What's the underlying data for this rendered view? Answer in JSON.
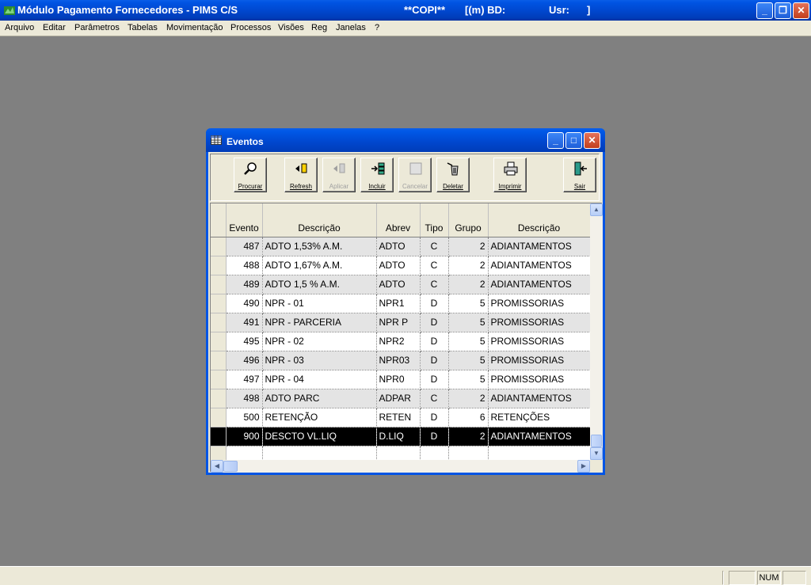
{
  "app": {
    "title": "Módulo Pagamento Fornecedores - PIMS C/S",
    "company": "**COPI**",
    "db_label": "[(m) BD:",
    "user_label": "Usr:",
    "close_bracket": "]",
    "win_buttons": {
      "minimize": "_",
      "restore": "❐",
      "close": "✕"
    }
  },
  "menu": {
    "items": [
      "Arquivo",
      "Editar",
      "Parâmetros",
      "Tabelas",
      "Movimentação",
      "Processos",
      "Visões",
      "Reg",
      "Janelas",
      "?"
    ]
  },
  "window": {
    "title": "Eventos",
    "buttons": {
      "minimize": "_",
      "maximize": "□",
      "close": "✕"
    }
  },
  "toolbar": {
    "buttons": [
      {
        "label": "Procurar",
        "enabled": true
      },
      {
        "label": "Refresh",
        "enabled": true
      },
      {
        "label": "Aplicar",
        "enabled": false
      },
      {
        "label": "Incluir",
        "enabled": true
      },
      {
        "label": "Cancelar",
        "enabled": false
      },
      {
        "label": "Deletar",
        "enabled": true
      },
      {
        "label": "Imprimir",
        "enabled": true
      },
      {
        "label": "Sair",
        "enabled": true
      }
    ]
  },
  "grid": {
    "columns": [
      "Evento",
      "Descrição",
      "Abrev",
      "Tipo",
      "Grupo",
      "Descrição"
    ],
    "rows": [
      [
        "487",
        "ADTO 1,53% A.M.",
        "ADTO",
        "C",
        "2",
        "ADIANTAMENTOS"
      ],
      [
        "488",
        "ADTO 1,67% A.M.",
        "ADTO",
        "C",
        "2",
        "ADIANTAMENTOS"
      ],
      [
        "489",
        "ADTO 1,5 % A.M.",
        "ADTO",
        "C",
        "2",
        "ADIANTAMENTOS"
      ],
      [
        "490",
        "NPR - 01",
        "NPR1",
        "D",
        "5",
        "PROMISSORIAS"
      ],
      [
        "491",
        "NPR - PARCERIA",
        "NPR P",
        "D",
        "5",
        "PROMISSORIAS"
      ],
      [
        "495",
        "NPR - 02",
        "NPR2",
        "D",
        "5",
        "PROMISSORIAS"
      ],
      [
        "496",
        "NPR - 03",
        "NPR03",
        "D",
        "5",
        "PROMISSORIAS"
      ],
      [
        "497",
        "NPR - 04",
        "NPR0",
        "D",
        "5",
        "PROMISSORIAS"
      ],
      [
        "498",
        "ADTO PARC",
        "ADPAR",
        "C",
        "2",
        "ADIANTAMENTOS"
      ],
      [
        "500",
        "RETENÇÃO",
        "RETEN",
        "D",
        "6",
        "RETENÇÕES"
      ],
      [
        "900",
        "DESCTO VL.LIQ",
        "D.LIQ",
        "D",
        "2",
        "ADIANTAMENTOS"
      ],
      [
        "",
        "",
        "",
        "",
        "",
        ""
      ]
    ],
    "selected_row": 10
  },
  "statusbar": {
    "num": "NUM"
  }
}
